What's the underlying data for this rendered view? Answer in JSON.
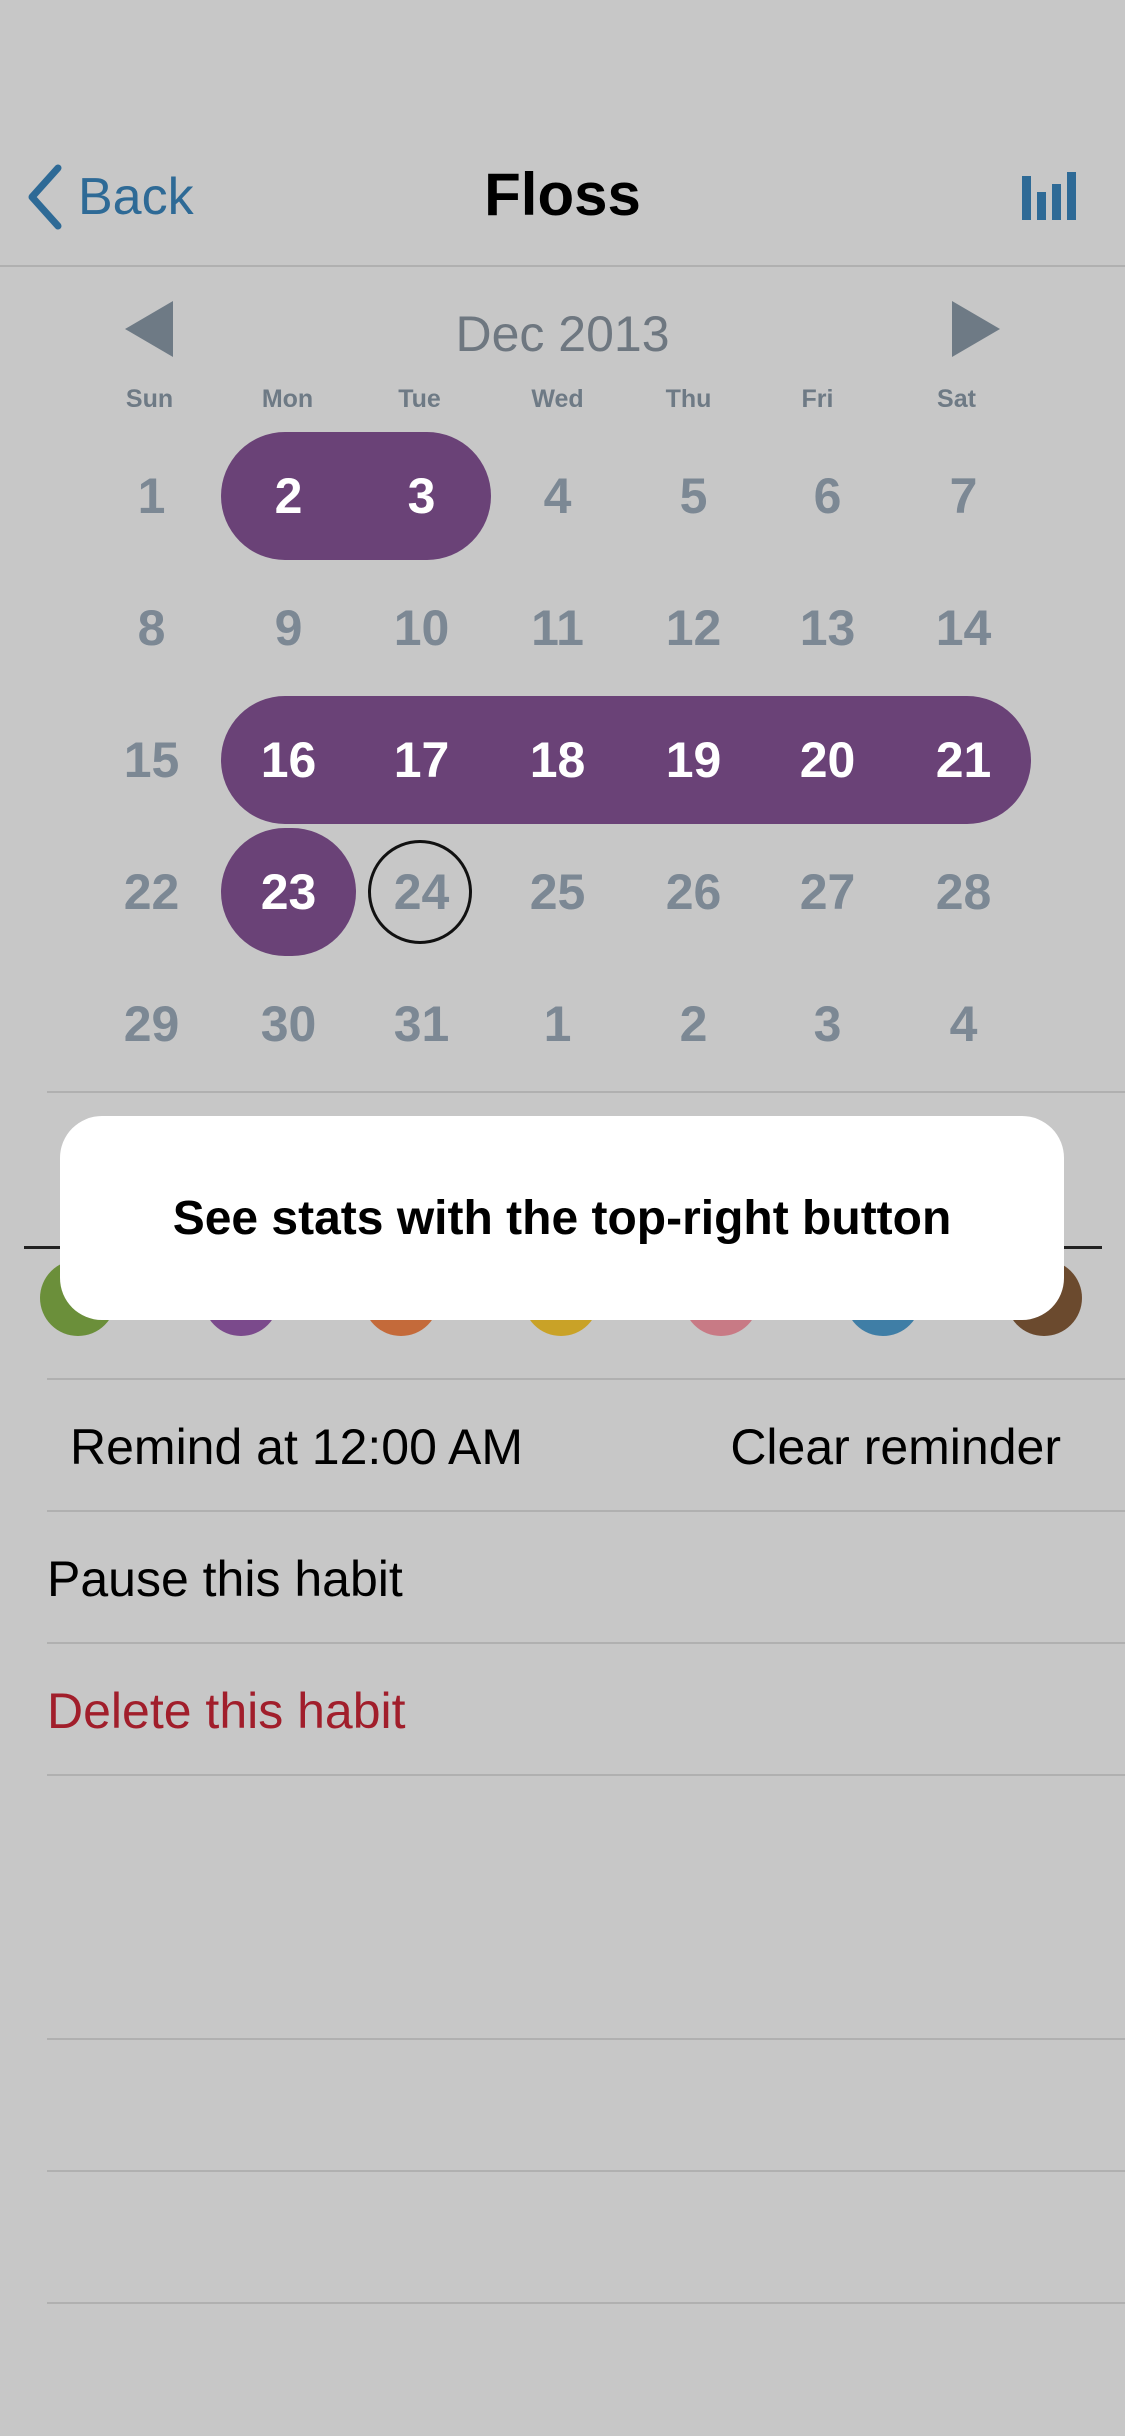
{
  "nav": {
    "back_label": "Back",
    "title": "Floss"
  },
  "calendar": {
    "month_label": "Dec 2013",
    "weekdays": [
      "Sun",
      "Mon",
      "Tue",
      "Wed",
      "Thu",
      "Fri",
      "Sat"
    ],
    "weeks": [
      [
        "1",
        "2",
        "3",
        "4",
        "5",
        "6",
        "7"
      ],
      [
        "8",
        "9",
        "10",
        "11",
        "12",
        "13",
        "14"
      ],
      [
        "15",
        "16",
        "17",
        "18",
        "19",
        "20",
        "21"
      ],
      [
        "22",
        "23",
        "24",
        "25",
        "26",
        "27",
        "28"
      ],
      [
        "29",
        "30",
        "31",
        "1",
        "2",
        "3",
        "4"
      ]
    ],
    "completed_days": [
      "2",
      "3",
      "16",
      "17",
      "18",
      "19",
      "20",
      "21",
      "23"
    ],
    "today": "24",
    "accent_color": "#6a4277"
  },
  "toast": {
    "message": "See stats with the top-right button"
  },
  "color_swatches": [
    "#6b8f3a",
    "#7b4a8c",
    "#c46a3a",
    "#c9a227",
    "#c87a85",
    "#3f7ea6",
    "#6b4a2e"
  ],
  "reminder": {
    "remind_label": "Remind at 12:00 AM",
    "clear_label": "Clear reminder"
  },
  "actions": {
    "pause_label": "Pause this habit",
    "delete_label": "Delete this habit"
  }
}
